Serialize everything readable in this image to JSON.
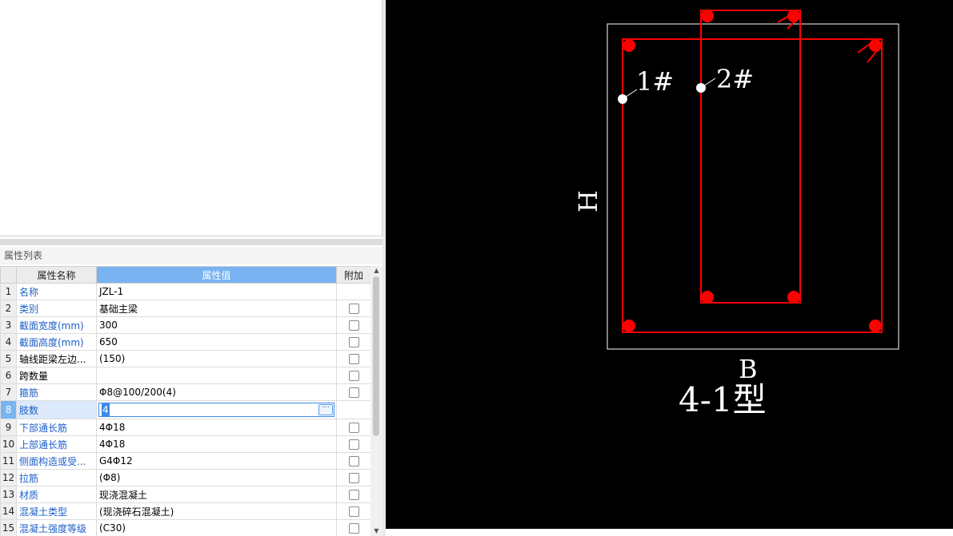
{
  "panel": {
    "title": "属性列表"
  },
  "grid": {
    "headers": {
      "name": "属性名称",
      "value": "属性值",
      "extra": "附加"
    },
    "rows": [
      {
        "no": "1",
        "name": "名称",
        "value": "JZL-1",
        "checkbox": false,
        "link": true
      },
      {
        "no": "2",
        "name": "类别",
        "value": "基础主梁",
        "checkbox": true,
        "link": true
      },
      {
        "no": "3",
        "name": "截面宽度(mm)",
        "value": "300",
        "checkbox": true,
        "link": true
      },
      {
        "no": "4",
        "name": "截面高度(mm)",
        "value": "650",
        "checkbox": true,
        "link": true
      },
      {
        "no": "5",
        "name": "轴线距梁左边...",
        "value": "(150)",
        "checkbox": true,
        "link": false
      },
      {
        "no": "6",
        "name": "跨数量",
        "value": "",
        "checkbox": true,
        "link": false
      },
      {
        "no": "7",
        "name": "箍筋",
        "value": "Φ8@100/200(4)",
        "checkbox": true,
        "link": true
      },
      {
        "no": "8",
        "name": "肢数",
        "value": "4",
        "checkbox": false,
        "link": true,
        "editing": true
      },
      {
        "no": "9",
        "name": "下部通长筋",
        "value": "4Φ18",
        "checkbox": true,
        "link": true
      },
      {
        "no": "10",
        "name": "上部通长筋",
        "value": "4Φ18",
        "checkbox": true,
        "link": true
      },
      {
        "no": "11",
        "name": "侧面构造或受...",
        "value": "G4Φ12",
        "checkbox": true,
        "link": true
      },
      {
        "no": "12",
        "name": "拉筋",
        "value": "(Φ8)",
        "checkbox": true,
        "link": true
      },
      {
        "no": "13",
        "name": "材质",
        "value": "现浇混凝土",
        "checkbox": true,
        "link": true
      },
      {
        "no": "14",
        "name": "混凝土类型",
        "value": "(现浇碎石混凝土)",
        "checkbox": true,
        "link": true
      },
      {
        "no": "15",
        "name": "混凝土强度等级",
        "value": "(C30)",
        "checkbox": true,
        "link": true
      }
    ]
  },
  "drawing": {
    "label_1": "1#",
    "label_2": "2#",
    "label_h": "H",
    "label_b": "B",
    "caption": "4-1型",
    "colors": {
      "background": "#000000",
      "rebar": "#ff0000",
      "outline": "#ffffff"
    }
  },
  "icons": {
    "more": "ellipsis-icon",
    "scroll_up": "triangle-up-icon",
    "scroll_down": "triangle-down-icon"
  }
}
